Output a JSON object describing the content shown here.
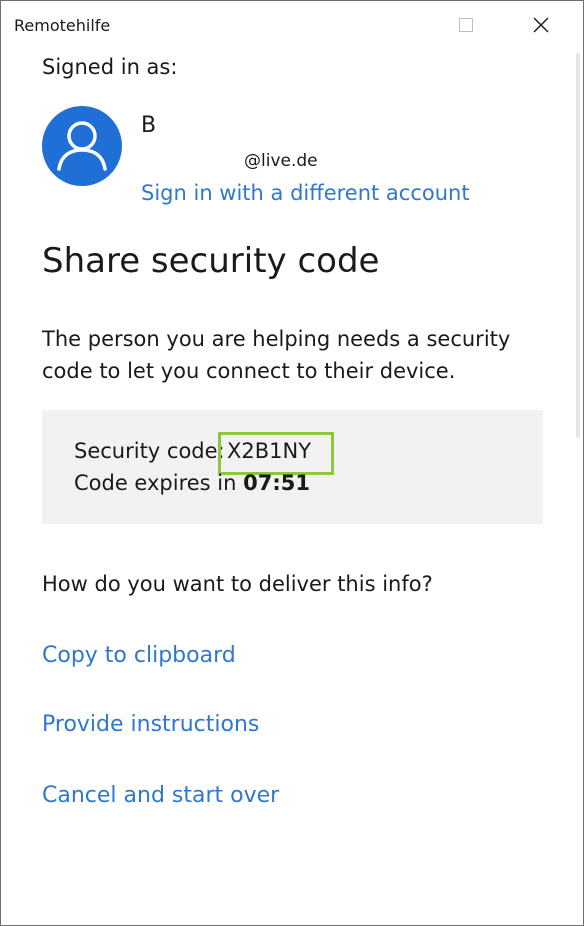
{
  "window": {
    "title": "Remotehilfe"
  },
  "account": {
    "signed_in_label": "Signed in as:",
    "name": "B",
    "email": "@live.de",
    "switch_link": "Sign in with a different account"
  },
  "main": {
    "heading": "Share security code",
    "description": "The person you are helping needs a security code to let you connect to their device.",
    "security_code_label": "Security code:",
    "security_code": "X2B1NY",
    "expires_label": "Code expires in",
    "expires_time": "07:51",
    "delivery_question": "How do you want to deliver this info?"
  },
  "options": {
    "copy": "Copy to clipboard",
    "instructions": "Provide instructions",
    "cancel": "Cancel and start over"
  },
  "colors": {
    "link": "#2f77cf",
    "avatar": "#1f6fd6",
    "highlight": "#8dc63f",
    "code_box": "#f2f2f2"
  }
}
